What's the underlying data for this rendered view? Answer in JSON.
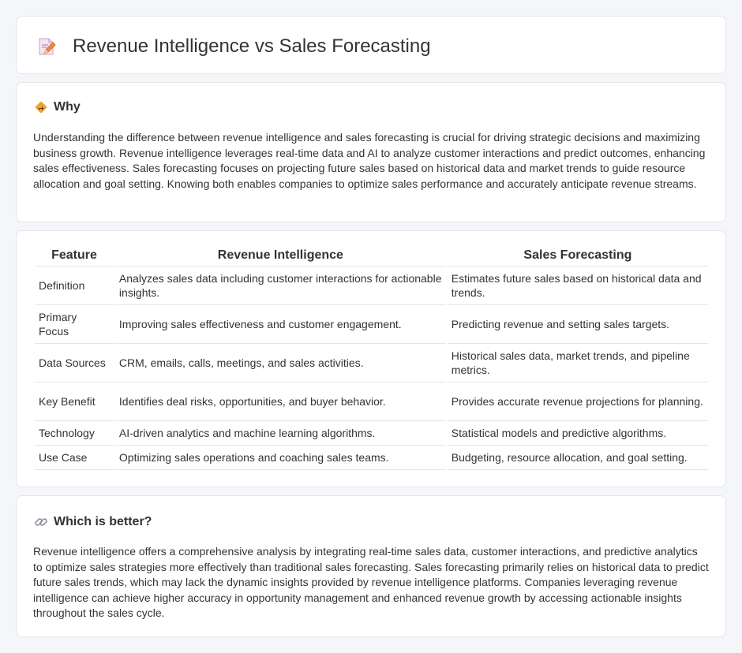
{
  "header": {
    "icon": "document-pencil-icon",
    "title": "Revenue Intelligence vs Sales Forecasting"
  },
  "why": {
    "icon": "diamond-sign-icon",
    "title": "Why",
    "text": "Understanding the difference between revenue intelligence and sales forecasting is crucial for driving strategic decisions and maximizing business growth. Revenue intelligence leverages real-time data and AI to analyze customer interactions and predict outcomes, enhancing sales effectiveness. Sales forecasting focuses on projecting future sales based on historical data and market trends to guide resource allocation and goal setting. Knowing both enables companies to optimize sales performance and accurately anticipate revenue streams."
  },
  "table": {
    "headers": [
      "Feature",
      "Revenue Intelligence",
      "Sales Forecasting"
    ],
    "rows": [
      [
        "Definition",
        "Analyzes sales data including customer interactions for actionable insights.",
        "Estimates future sales based on historical data and trends."
      ],
      [
        "Primary Focus",
        "Improving sales effectiveness and customer engagement.",
        "Predicting revenue and setting sales targets."
      ],
      [
        "Data Sources",
        "CRM, emails, calls, meetings, and sales activities.",
        "Historical sales data, market trends, and pipeline metrics."
      ],
      [
        "Key Benefit",
        "Identifies deal risks, opportunities, and buyer behavior.",
        "Provides accurate revenue projections for planning."
      ],
      [
        "Technology",
        "AI-driven analytics and machine learning algorithms.",
        "Statistical models and predictive algorithms."
      ],
      [
        "Use Case",
        "Optimizing sales operations and coaching sales teams.",
        "Budgeting, resource allocation, and goal setting."
      ]
    ]
  },
  "better": {
    "icon": "link-icon",
    "title": "Which is better?",
    "text": "Revenue intelligence offers a comprehensive analysis by integrating real-time sales data, customer interactions, and predictive analytics to optimize sales strategies more effectively than traditional sales forecasting. Sales forecasting primarily relies on historical data to predict future sales trends, which may lack the dynamic insights provided by revenue intelligence platforms. Companies leveraging revenue intelligence can achieve higher accuracy in opportunity management and enhanced revenue growth by accessing actionable insights throughout the sales cycle."
  },
  "colors": {
    "page_background": "#f4f6f9",
    "card_background": "#ffffff",
    "border": "#e3e6eb",
    "text": "#333333",
    "accent_orange": "#f0a030"
  }
}
